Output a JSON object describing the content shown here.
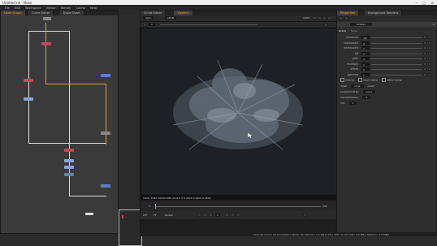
{
  "window": {
    "title": "Untitled.nk - Nuke"
  },
  "menubar": {
    "items": [
      "File",
      "Edit",
      "Workspace",
      "Viewer",
      "Render",
      "Cache",
      "Help"
    ]
  },
  "left_panel": {
    "tabs": [
      "Node Graph",
      "Curve Editor",
      "Dope Sheet"
    ],
    "active_tab": 0
  },
  "center_panel": {
    "tabs": [
      "Script Editor",
      "Viewer1"
    ],
    "active_tab": 1,
    "toolbar": {
      "channels": "rgba",
      "colorspace": "sRGB",
      "frame_label": "1",
      "zoom": "100%"
    },
    "status_line": "1920, 1080  1920x1080  bbox 0 0  0.2600 0.2600 0.2600",
    "timeline": {
      "start": "1",
      "end": "100",
      "current": "1",
      "fps": "24*",
      "mode": "TF",
      "playback": "Global"
    }
  },
  "right_panel": {
    "tabs": [
      "Properties",
      "Background Renders"
    ],
    "active_tab": 0,
    "node_name": "Grade1",
    "sub_tabs": [
      "Grade",
      "Node"
    ],
    "rows": [
      {
        "label": "channels",
        "value": "rgb"
      },
      {
        "label": "blackpoint",
        "value": "0"
      },
      {
        "label": "whitepoint",
        "value": "1"
      },
      {
        "label": "lift",
        "value": "0"
      },
      {
        "label": "gain",
        "value": "1"
      },
      {
        "label": "multiply",
        "value": "1"
      },
      {
        "label": "offset",
        "value": "0"
      },
      {
        "label": "gamma",
        "value": "1"
      }
    ],
    "reverse_label": "reverse",
    "black_clamp_label": "black clamp",
    "white_clamp_label": "white clamp",
    "mask_label": "mask",
    "mask_value": "none",
    "unpremult_label": "(un)premult by",
    "unpremult_value": "none",
    "invert_label": "invert",
    "mix_luminance_label": "mix luminance",
    "mix_luminance_value": "0",
    "mix_label": "mix",
    "mix_value": "1"
  },
  "statusbar": {
    "text": "Channel Count: 18  Localization Mode: On  Memory: 1.2 GB (7.6%)  CPU: 12.3%  Disk: 0.0 MB/s  Network: 0.0 MB/s"
  },
  "colors": {
    "accent": "#e0a030",
    "node_red": "#c8485a",
    "node_blue": "#5b7fc8",
    "node_lightblue": "#8aa4d8"
  }
}
